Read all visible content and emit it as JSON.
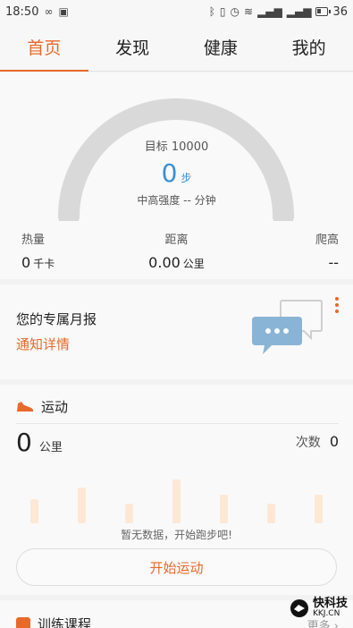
{
  "status_bar": {
    "time": "18:50",
    "battery": "36",
    "battery_level": 0.36
  },
  "tabs": [
    {
      "label": "首页",
      "active": true
    },
    {
      "label": "发现",
      "active": false
    },
    {
      "label": "健康",
      "active": false
    },
    {
      "label": "我的",
      "active": false
    }
  ],
  "summary": {
    "goal": "目标 10000",
    "steps": "0",
    "steps_unit": "步",
    "intensity": "中高强度 -- 分钟",
    "progress": 0,
    "stats": [
      {
        "label": "热量",
        "value": "0",
        "unit": "千卡"
      },
      {
        "label": "距离",
        "value": "0.00",
        "unit": "公里"
      },
      {
        "label": "爬高",
        "value": "--",
        "unit": ""
      }
    ]
  },
  "report": {
    "title": "您的专属月报",
    "link": "通知详情"
  },
  "sport": {
    "title": "运动",
    "distance": "0",
    "distance_unit": "公里",
    "count_label": "次数",
    "count": "0",
    "no_data": "暂无数据，开始跑步吧!",
    "start_button": "开始运动"
  },
  "training": {
    "title": "训练课程",
    "more": "更多"
  },
  "watermark": {
    "title": "快科技",
    "subtitle": "KKJ.CN"
  },
  "colors": {
    "accent": "#e8692a",
    "steps": "#3a8fd6",
    "gauge": "#d9d9d9"
  }
}
